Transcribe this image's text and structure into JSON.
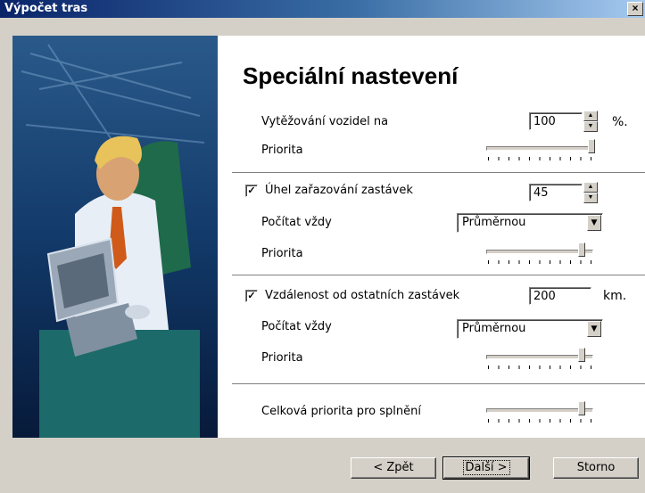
{
  "window": {
    "title": "Výpočet tras",
    "close_glyph": "×"
  },
  "page": {
    "heading": "Speciální nastevení"
  },
  "vehicle": {
    "label": "Vytěžování vozidel na",
    "value": "100",
    "unit": "%.",
    "priority_label": "Priorita",
    "priority_level": 1.0
  },
  "angle": {
    "checkbox_checked": true,
    "checkbox_label": "Úhel zařazování zastávek",
    "value": "45",
    "compute_label": "Počítat vždy",
    "compute_value": "Průměrnou",
    "priority_label": "Priorita",
    "priority_level": 0.9
  },
  "distance": {
    "checkbox_checked": true,
    "checkbox_label": "Vzdálenost od ostatních zastávek",
    "value": "200",
    "unit": "km.",
    "compute_label": "Počítat vždy",
    "compute_value": "Průměrnou",
    "priority_label": "Priorita",
    "priority_level": 0.9
  },
  "total": {
    "label": "Celková priorita pro splnění",
    "priority_level": 0.9
  },
  "buttons": {
    "back": "< Zpět",
    "next": "Další >",
    "cancel": "Storno"
  },
  "icons": {
    "spin_up": "▲",
    "spin_down": "▼",
    "dropdown": "▼",
    "check": "✓"
  }
}
